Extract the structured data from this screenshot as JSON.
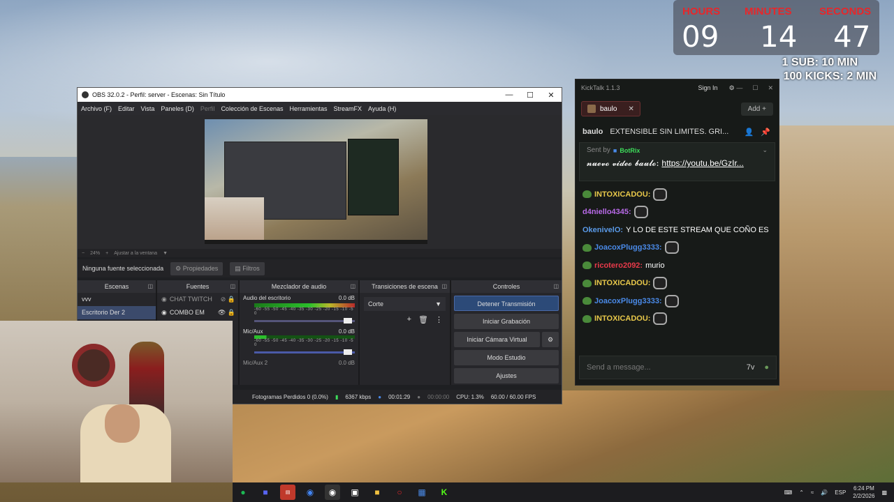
{
  "timer": {
    "labels": [
      "HOURS",
      "MINUTES",
      "SECONDS"
    ],
    "values": [
      "09",
      "14",
      "47"
    ],
    "rules": [
      "1 SUB: 10 MIN",
      "100 KICKS: 2 MIN"
    ]
  },
  "obs": {
    "title": "OBS 32.0.2 - Perfil: server - Escenas: Sin Título",
    "menu": [
      "Archivo (F)",
      "Editar",
      "Vista",
      "Paneles (D)",
      "Perfil",
      "Colección de Escenas",
      "Herramientas",
      "StreamFX",
      "Ayuda (H)"
    ],
    "zoom": "24%",
    "fit": "Ajustar a la ventana",
    "no_source": "Ninguna fuente seleccionada",
    "properties": "Propiedades",
    "filters": "Filtros",
    "docks": {
      "scenes": "Escenas",
      "sources": "Fuentes",
      "mixer": "Mezclador de audio",
      "transitions": "Transiciones de escena",
      "controls": "Controles"
    },
    "scenes": [
      "vvv",
      "Escritorio Der 2"
    ],
    "sources": [
      "CHAT TWITCH",
      "COMBO EM"
    ],
    "mixer": [
      {
        "name": "Audio del escritorio",
        "db": "0.0 dB"
      },
      {
        "name": "Mic/Aux",
        "db": "0.0 dB"
      },
      {
        "name": "Mic/Aux 2",
        "db": "0.0 dB"
      }
    ],
    "scale": "-60 -55 -50 -45 -40 -35 -30 -25 -20 -15 -10 -5 0",
    "transition": "Corte",
    "controls": [
      "Detener Transmisión",
      "Iniciar Grabación",
      "Iniciar Cámara Virtual",
      "Modo Estudio",
      "Ajustes"
    ],
    "status": {
      "dropped": "Fotogramas Perdidos 0 (0.0%)",
      "kbps": "6367 kbps",
      "live": "00:01:29",
      "rec": "00:00:00",
      "cpu": "CPU: 1.3%",
      "fps": "60.00 / 60.00 FPS"
    }
  },
  "kicktalk": {
    "title": "KickTalk 1.1.3",
    "sign_in": "Sign In",
    "tab": "baulo",
    "add": "Add +",
    "pinned_user": "baulo",
    "pinned_msg": "EXTENSIBLE SIN LIMITES. GRI...",
    "sent_by": "Sent by",
    "bot": "BotRix",
    "bot_text": "𝓷𝓾𝓮𝓿𝓸 𝓿𝓲𝓭𝓮𝓸 𝓫𝓪𝓾𝓵𝓸:",
    "bot_link": "https://youtu.be/GzIr...",
    "messages": [
      {
        "user": "INTOXICADOU:",
        "text": "",
        "color": "#e8c84a",
        "badge": true,
        "emote": true
      },
      {
        "user": "d4niello4345:",
        "text": "",
        "color": "#b86ae8",
        "badge": false,
        "emote": true
      },
      {
        "user": "OkenivelO:",
        "text": "Y LO DE ESTE STREAM QUE COÑO ES",
        "color": "#5a9ae8",
        "badge": false,
        "emote": false
      },
      {
        "user": "JoacoxPlugg3333:",
        "text": "",
        "color": "#4a8ae8",
        "badge": true,
        "emote": true
      },
      {
        "user": "ricotero2092:",
        "text": "murio",
        "color": "#e83a4a",
        "badge": true,
        "emote": false
      },
      {
        "user": "INTOXICADOU:",
        "text": "",
        "color": "#e8c84a",
        "badge": true,
        "emote": true
      },
      {
        "user": "JoacoxPlugg3333:",
        "text": "",
        "color": "#4a8ae8",
        "badge": true,
        "emote": true
      },
      {
        "user": "INTOXICADOU:",
        "text": "",
        "color": "#e8c84a",
        "badge": true,
        "emote": true
      }
    ],
    "placeholder": "Send a message..."
  },
  "taskbar": {
    "lang": "ESP",
    "time": "6:24 PM",
    "date": "2/2/2026"
  }
}
